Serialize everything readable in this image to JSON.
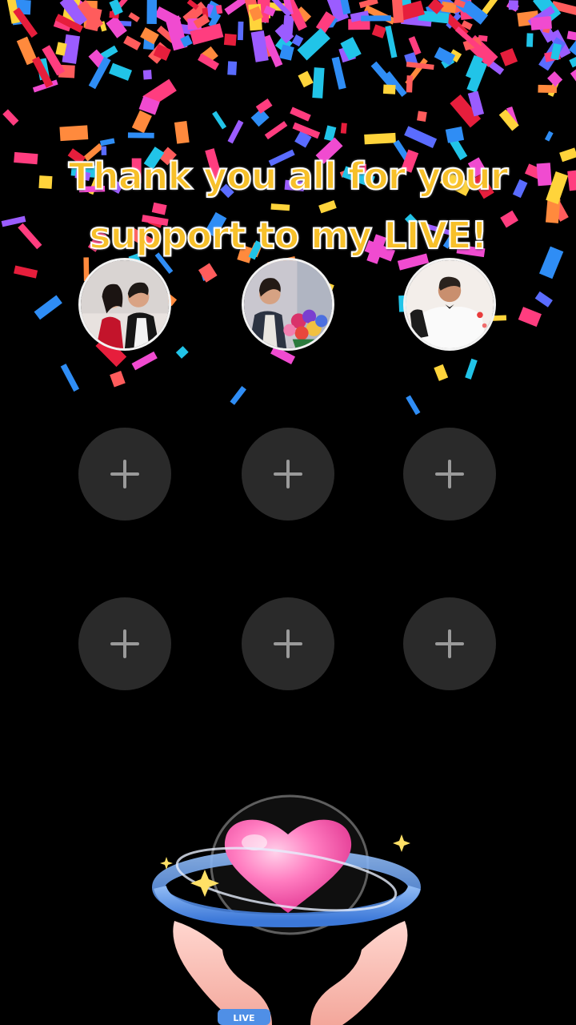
{
  "screen": {
    "title_line1": "Thank you all for your",
    "title_line2": "support to my LIVE!"
  },
  "top_supporters": [
    {
      "name": "supporter-avatar-1",
      "icon": "couple-photo"
    },
    {
      "name": "supporter-avatar-2",
      "icon": "man-with-flowers-photo"
    },
    {
      "name": "supporter-avatar-3",
      "icon": "man-in-white-shirt-photo"
    }
  ],
  "empty_slots": [
    {
      "icon": "plus-icon"
    },
    {
      "icon": "plus-icon"
    },
    {
      "icon": "plus-icon"
    },
    {
      "icon": "plus-icon"
    },
    {
      "icon": "plus-icon"
    },
    {
      "icon": "plus-icon"
    }
  ],
  "colors": {
    "title": "#f7c02a",
    "slot_bg": "#2a2a2a",
    "heart": "#ff6fb5",
    "ring": "#4f8fe6"
  },
  "badge": {
    "text": "LIVE"
  }
}
